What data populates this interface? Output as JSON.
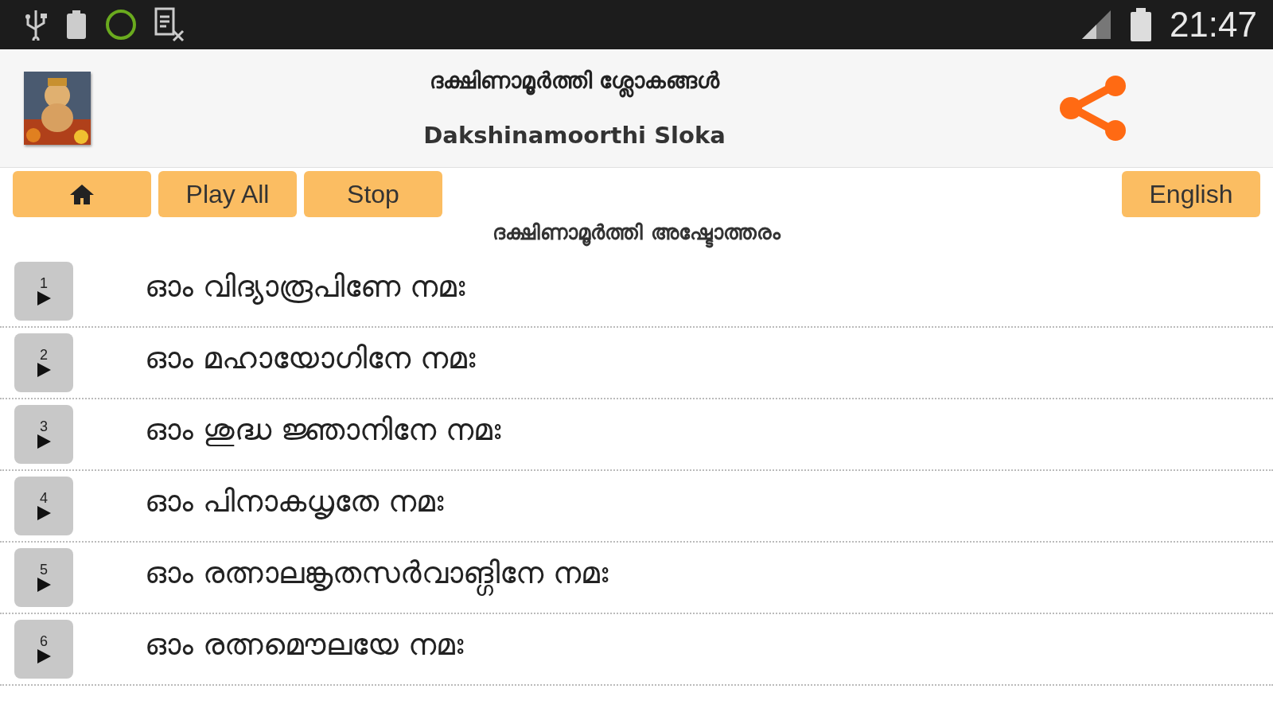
{
  "status_bar": {
    "time": "21:47"
  },
  "header": {
    "title": "ദക്ഷിണാമൂർത്തി ശ്ലോകങ്ങൾ",
    "subtitle": "Dakshinamoorthi Sloka"
  },
  "toolbar": {
    "buttons": [
      {
        "kind": "home"
      },
      {
        "kind": "text",
        "label": "Play All"
      },
      {
        "kind": "text",
        "label": "Stop"
      }
    ],
    "language_button": "English"
  },
  "list": {
    "heading": "ദക്ഷിണാമൂർത്തി അഷ്ടോത്തരം",
    "items": [
      {
        "number": "1",
        "text": "ഓം വിദ്യാരൂപിണേ നമഃ"
      },
      {
        "number": "2",
        "text": "ഓം മഹായോഗിനേ നമഃ"
      },
      {
        "number": "3",
        "text": "ഓം ശുദ്ധ ജ്ഞാനിനേ നമഃ"
      },
      {
        "number": "4",
        "text": "ഓം പിനാകധൃതേ നമഃ"
      },
      {
        "number": "5",
        "text": "ഓം രത്നാലങ്കൃതസർവാങ്ഗിനേ നമഃ"
      },
      {
        "number": "6",
        "text": "ഓം രത്നമൌലയേ നമഃ"
      }
    ]
  }
}
